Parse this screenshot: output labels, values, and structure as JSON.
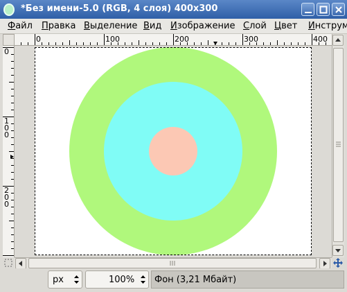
{
  "window": {
    "title": "*Без имени-5.0 (RGB, 4 слоя) 400x300"
  },
  "menu": [
    {
      "label": "Файл",
      "mnemonic": "Ф",
      "rest": "айл"
    },
    {
      "label": "Правка",
      "mnemonic": "П",
      "rest": "равка"
    },
    {
      "label": "Выделение",
      "mnemonic": "В",
      "rest": "ыделение"
    },
    {
      "label": "Вид",
      "mnemonic": "В",
      "rest": "ид"
    },
    {
      "label": "Изображение",
      "mnemonic": "И",
      "rest": "зображение"
    },
    {
      "label": "Слой",
      "mnemonic": "С",
      "rest": "лой"
    },
    {
      "label": "Цвет",
      "mnemonic": "Ц",
      "rest": "вет"
    },
    {
      "label": "Инструм",
      "mnemonic": "И",
      "rest": "нструм"
    }
  ],
  "rulers": {
    "horizontal_labels": [
      "0",
      "100",
      "200",
      "300",
      "400"
    ],
    "vertical_labels": [
      "0",
      "100",
      "200"
    ]
  },
  "image": {
    "background": "#ffffff",
    "rings": [
      {
        "name": "outer-ring",
        "color": "#b0f87c"
      },
      {
        "name": "middle-ring",
        "color": "#80fcf6"
      },
      {
        "name": "inner-circle",
        "color": "#fcc8b4"
      }
    ]
  },
  "status": {
    "unit": "px",
    "zoom": "100%",
    "message": "Фон (3,21 Мбайт)"
  }
}
